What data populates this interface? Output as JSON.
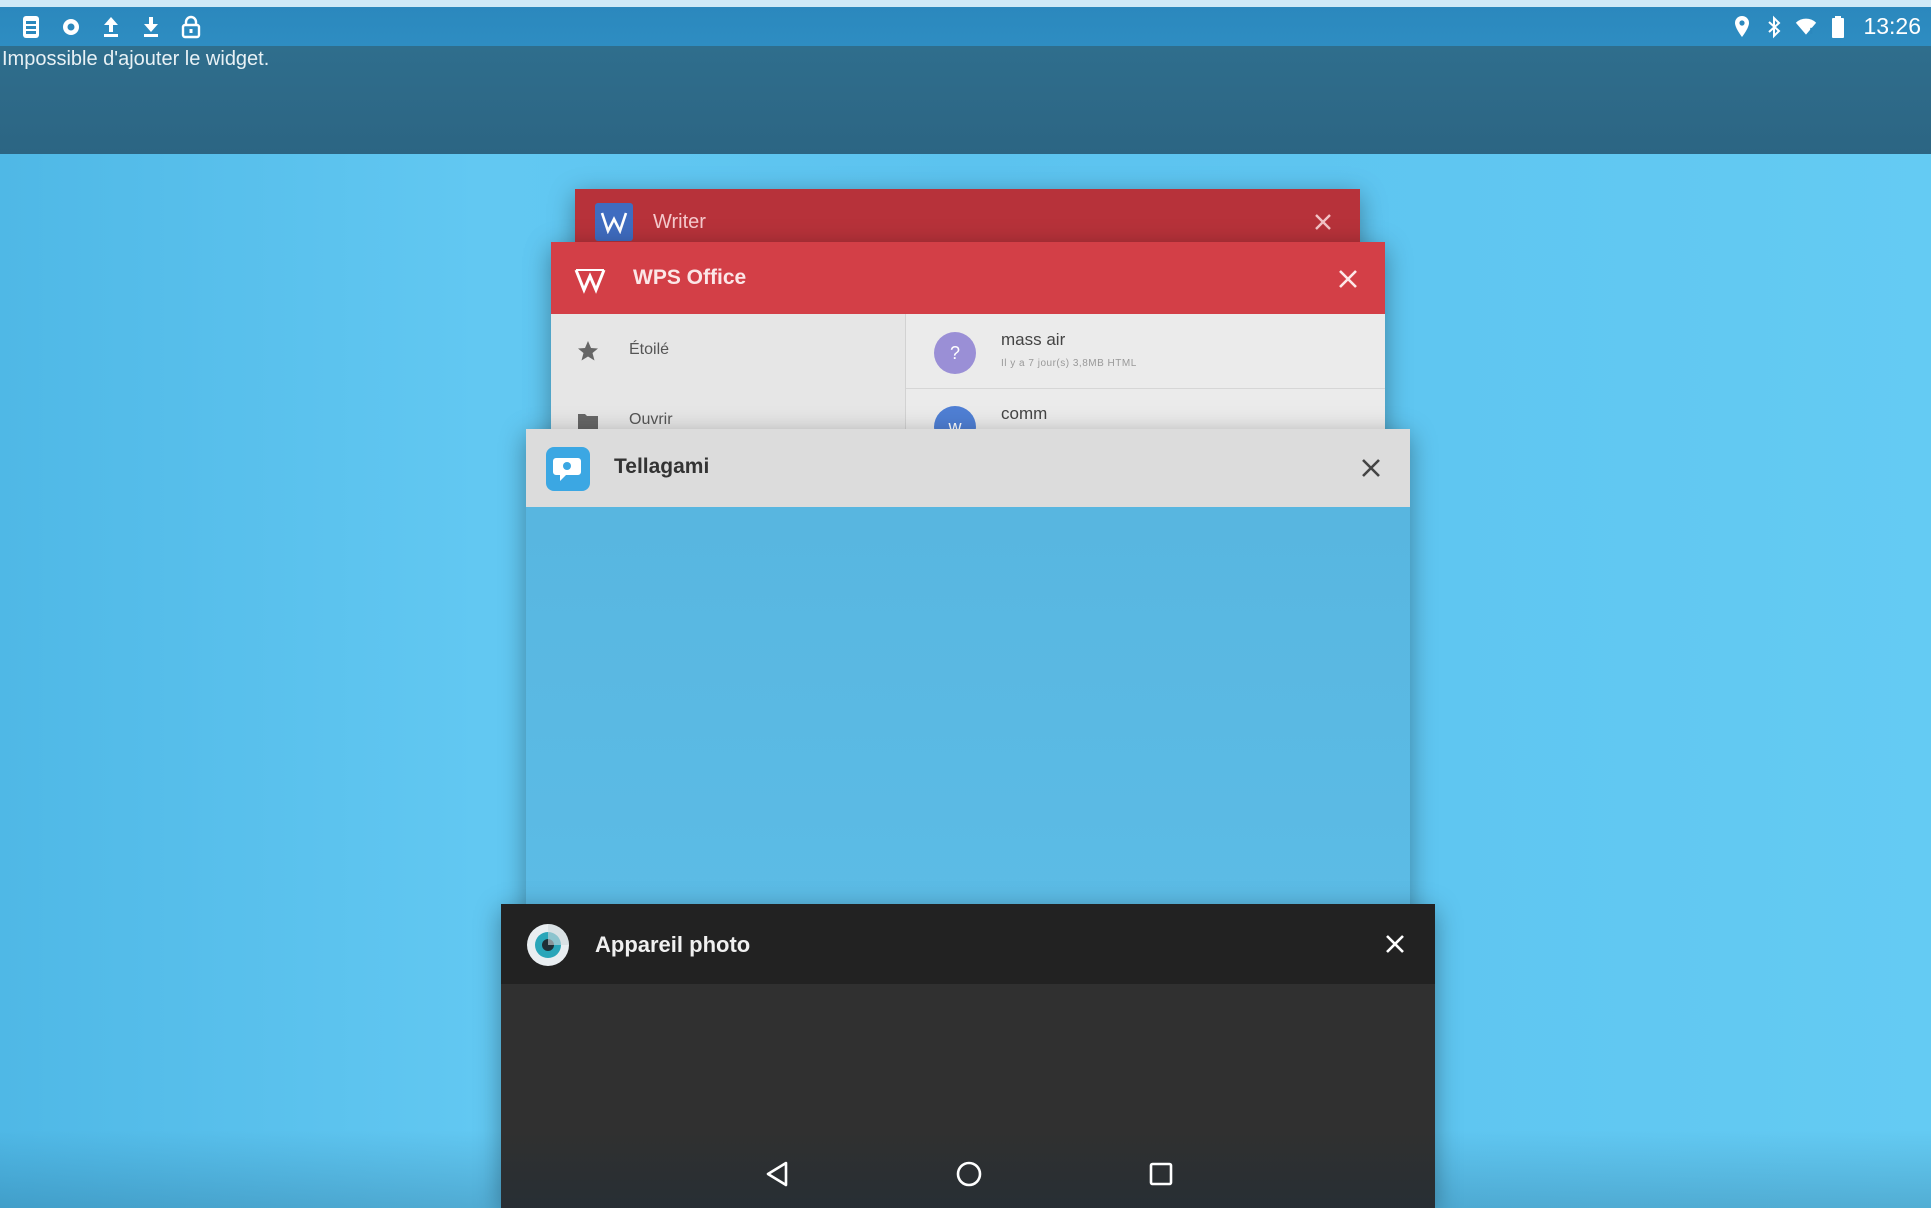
{
  "status_bar": {
    "left_icons": [
      "sim-card-icon",
      "settings-icon",
      "upload-icon",
      "download-icon",
      "lock-icon"
    ],
    "right_icons": [
      "location-icon",
      "bluetooth-icon",
      "wifi-icon",
      "battery-icon"
    ],
    "time": "13:26"
  },
  "toast": {
    "message": "Impossible d'ajouter le widget."
  },
  "recents": [
    {
      "app": "Writer",
      "icon": "writer-icon",
      "header_color": "#b7323a"
    },
    {
      "app": "WPS Office",
      "icon": "wps-office-icon",
      "header_color": "#d33f47",
      "sidebar": [
        {
          "label": "Étoilé",
          "icon": "star-icon"
        },
        {
          "label": "Ouvrir",
          "icon": "folder-icon"
        }
      ],
      "files": [
        {
          "name": "mass air",
          "avatar": "?",
          "meta": "Il y a 7 jour(s)     3,8MB     HTML",
          "color": "#9a8fd6"
        },
        {
          "name": "comm",
          "avatar": "w",
          "meta": "",
          "color": "#4f7fd4"
        }
      ]
    },
    {
      "app": "Tellagami",
      "icon": "tellagami-icon",
      "header_color": "#dcdcdc"
    },
    {
      "app": "Appareil photo",
      "icon": "camera-icon",
      "header_color": "#222222"
    }
  ],
  "nav": {
    "buttons": [
      "back-icon",
      "home-icon",
      "recent-apps-icon"
    ]
  }
}
